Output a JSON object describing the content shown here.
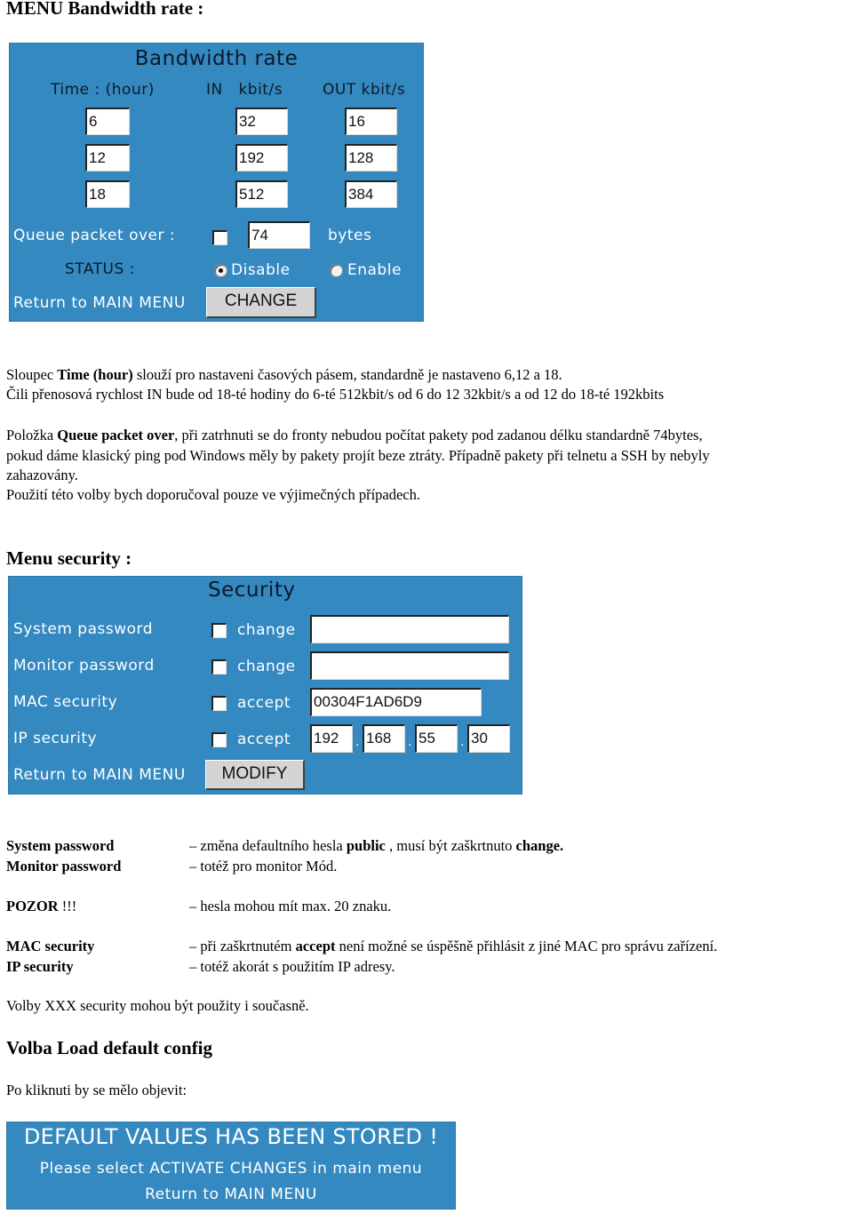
{
  "doc": {
    "section1_title": "MENU Bandwidth rate :",
    "section2_title": "Menu security :",
    "section3_title": "Volba  Load default config"
  },
  "bandwidth_panel": {
    "title": "Bandwidth rate",
    "col_time": "Time : (hour)",
    "col_in": "IN   kbit/s",
    "col_out": "OUT kbit/s",
    "rows": [
      {
        "time": "6",
        "in": "32",
        "out": "16"
      },
      {
        "time": "12",
        "in": "192",
        "out": "128"
      },
      {
        "time": "18",
        "in": "512",
        "out": "384"
      }
    ],
    "queue_label": "Queue packet over :",
    "queue_checked": false,
    "queue_value": "74",
    "queue_unit": "bytes",
    "status_label": "STATUS :",
    "status_options": [
      "Disable",
      "Enable"
    ],
    "status_selected": "Disable",
    "return_link": "Return to MAIN MENU",
    "change_button": "CHANGE"
  },
  "para1": {
    "line1_pre": "Sloupec ",
    "line1_bold": "Time (hour)",
    "line1_post": " slouží pro nastaveni časových pásem, standardně je nastaveno 6,12 a 18.",
    "line2": "Čili přenosová rychlost IN bude od 18-té hodiny do 6-té 512kbit/s od 6 do 12 32kbit/s a od 12 do 18-té 192kbits"
  },
  "para2": {
    "line1_pre": "Položka ",
    "line1_bold": "Queue packet over",
    "line1_post": ", při zatrhnuti se do fronty  nebudou počítat pakety pod zadanou délku standardně 74bytes,",
    "line2": "pokud dáme klasický ping pod Windows  měly by pakety projít beze ztráty. Případně pakety při telnetu a  SSH by nebyly",
    "line3": "zahazovány.",
    "line4": "Použití této volby bych doporučoval pouze ve výjimečných případech."
  },
  "security_panel": {
    "title": "Security",
    "rows": [
      {
        "label": "System password",
        "action": "change",
        "value": ""
      },
      {
        "label": "Monitor password",
        "action": "change",
        "value": ""
      },
      {
        "label": "MAC security",
        "action": "accept",
        "value": "00304F1AD6D9"
      },
      {
        "label": "IP security",
        "action": "accept",
        "ip": [
          "192",
          "168",
          "55",
          "30"
        ]
      }
    ],
    "ip_separator": ".",
    "return_link": "Return to MAIN MENU",
    "modify_button": "MODIFY"
  },
  "security_notes": [
    {
      "term": "System password",
      "dash": "–",
      "pre": " změna defaultního hesla ",
      "bold1": "public",
      "mid": " , musí být zaškrtnuto ",
      "bold2": "change."
    },
    {
      "term": "Monitor password",
      "dash": "–",
      "pre": " totéž pro monitor Mód."
    },
    {
      "term": "POZOR",
      "term_suffix": " !!!",
      "dash": "–",
      "pre": " hesla mohou mít max. 20 znaku."
    },
    {
      "term": "MAC security",
      "dash": "–",
      "pre": " při zaškrtnutém ",
      "bold1": "accept",
      "mid": "  není možné se úspěšně přihlásit z jiné MAC pro správu zařízení."
    },
    {
      "term": "IP security",
      "dash": "–",
      "pre": " totéž akorát s použitím IP adresy."
    }
  ],
  "para3": "Volby XXX security mohou být použity i současně.",
  "para4": "Po kliknuti by se mělo objevit:",
  "default_panel": {
    "headline": "DEFAULT VALUES HAS BEEN STORED !",
    "message": "Please select ACTIVATE CHANGES in main menu",
    "return_link": "Return to MAIN MENU"
  }
}
